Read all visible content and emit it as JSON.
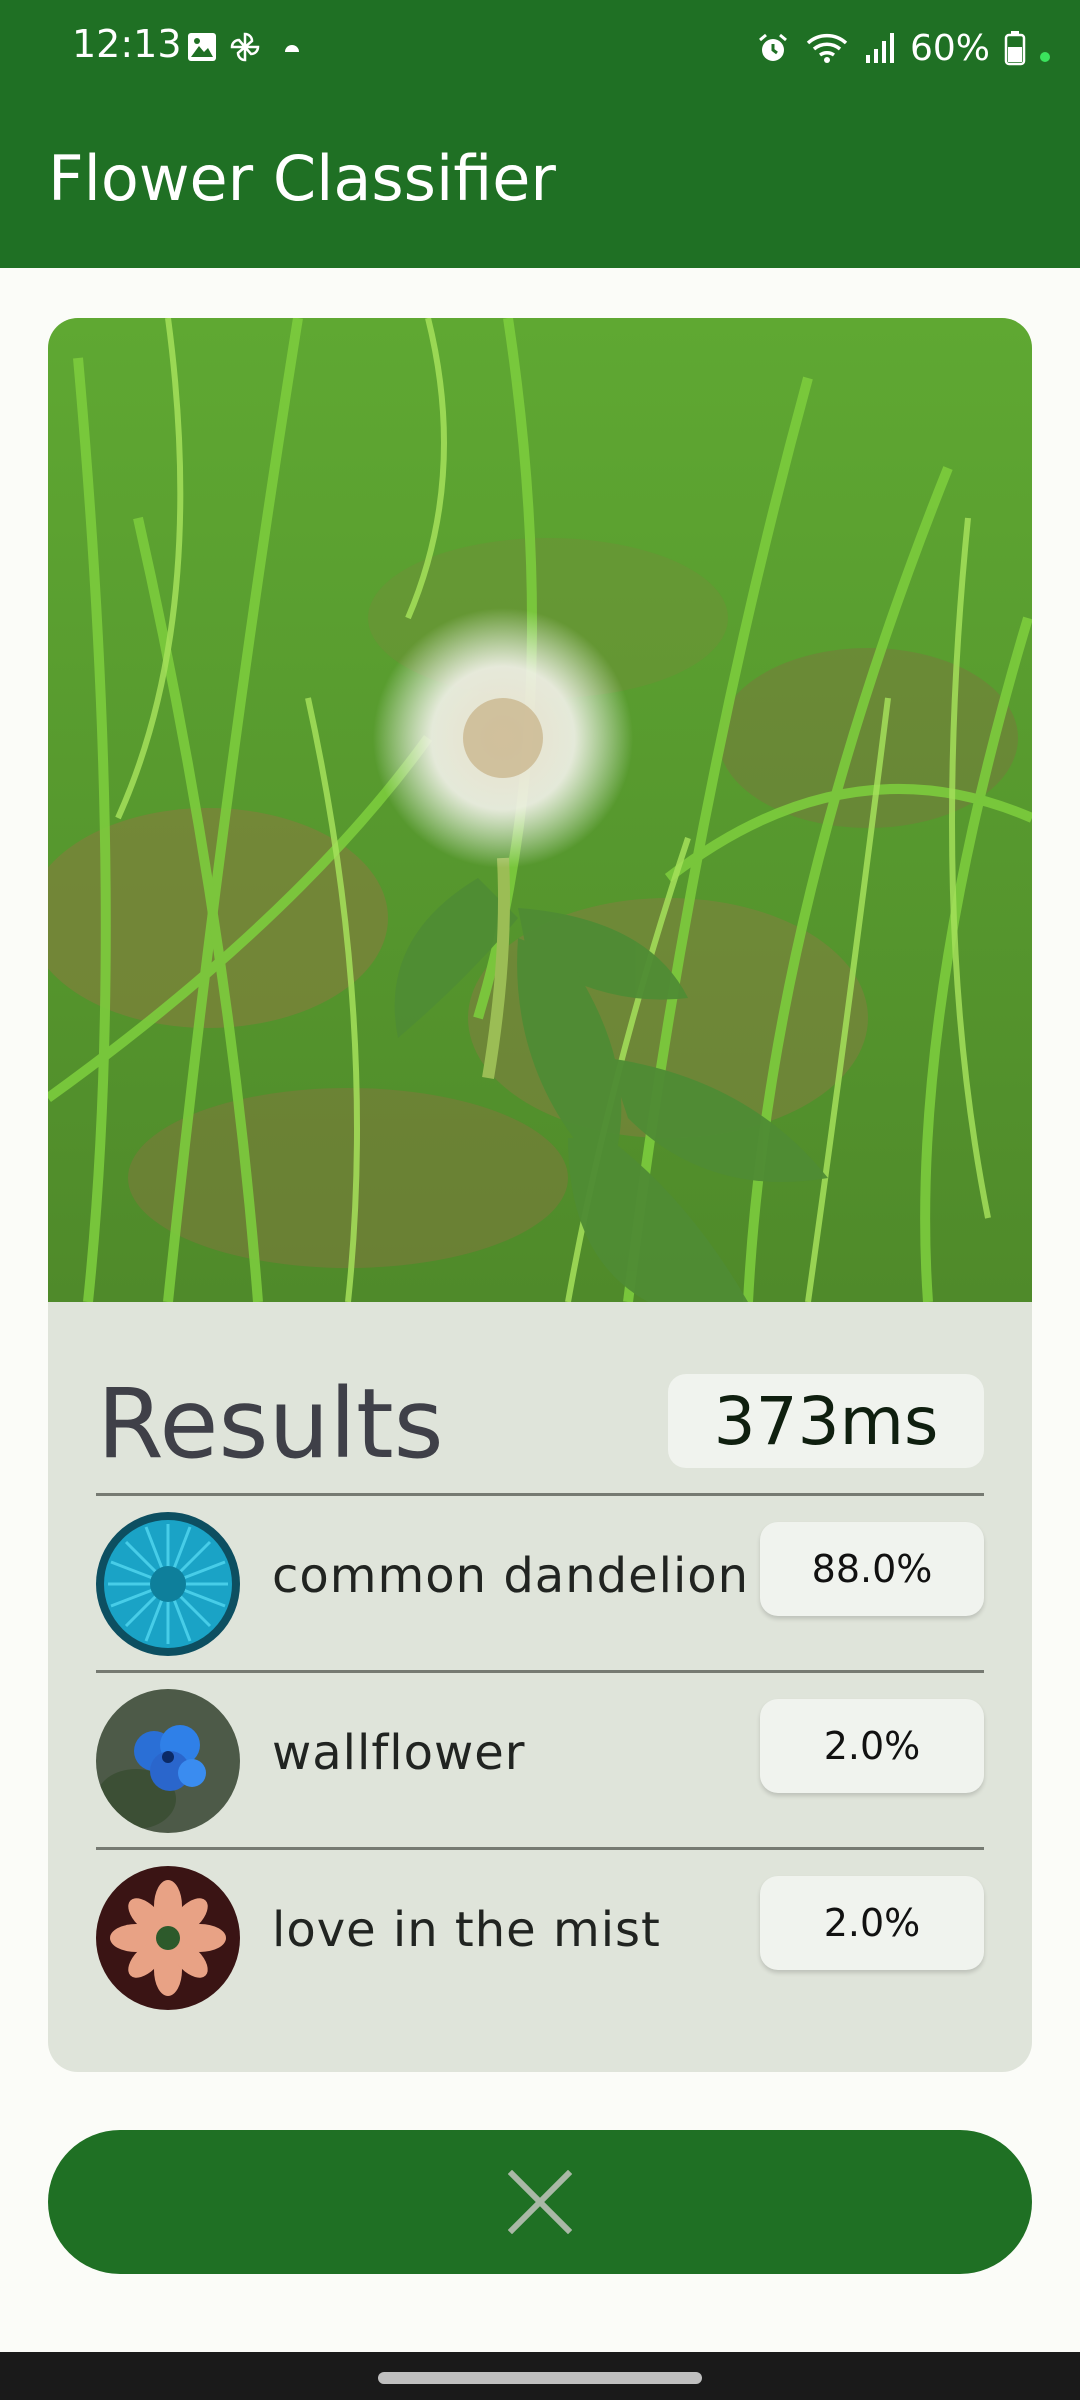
{
  "status_bar": {
    "time": "12:13",
    "battery": "60%",
    "icons": [
      "image-icon",
      "pinwheel-icon",
      "android-icon",
      "alarm-icon",
      "wifi-icon",
      "signal-icon",
      "battery-icon"
    ]
  },
  "app_bar": {
    "title": "Flower Classifier"
  },
  "results": {
    "title": "Results",
    "inference_time": "373ms",
    "items": [
      {
        "label": "common dandelion",
        "score": "88.0%",
        "thumb_color": "#1AA3C6"
      },
      {
        "label": "wallflower",
        "score": "2.0%",
        "thumb_color": "#2A6FD6"
      },
      {
        "label": "love in the mist",
        "score": "2.0%",
        "thumb_color": "#E8A285"
      }
    ]
  },
  "close_button": {
    "icon": "close-icon"
  },
  "colors": {
    "primary": "#1F7024",
    "card_bg": "#DFE4DA",
    "chip_bg": "#F0F3EE",
    "background": "#FBFCF8"
  }
}
